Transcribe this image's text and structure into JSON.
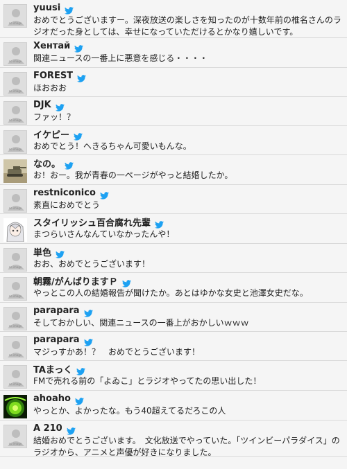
{
  "avatar_placeholder": "no image",
  "icons": {
    "account": "twitter-bird-icon",
    "color": "#1da1f2"
  },
  "tweets": [
    {
      "name": "yuusi",
      "text": "おめでとうございますー。深夜放送の楽しさを知ったのが十数年前の椎名さんのラジオだった身としては、幸せになっていただけるとかなり嬉しいです。",
      "avatar": "placeholder"
    },
    {
      "name": "Хентай",
      "text": "関連ニュースの一番上に悪意を感じる・・・・",
      "avatar": "placeholder"
    },
    {
      "name": "FOREST",
      "text": "ほおおお",
      "avatar": "placeholder"
    },
    {
      "name": "DJK",
      "text": "ファッ！？",
      "avatar": "placeholder"
    },
    {
      "name": "イケピー",
      "text": "おめでとう！へきるちゃん可愛いもんな。",
      "avatar": "placeholder"
    },
    {
      "name": "なの。",
      "text": "お！おー。我が青春の一ページがやっと結婚したか。",
      "avatar": "photo-tank"
    },
    {
      "name": "restniconico",
      "text": "素直におめでとう",
      "avatar": "placeholder"
    },
    {
      "name": "スタイリッシュ百合腐れ先輩",
      "text": "まつらいさんなんていなかったんや！",
      "avatar": "photo-anime"
    },
    {
      "name": "単色",
      "text": "おお、おめでとうございます！",
      "avatar": "placeholder"
    },
    {
      "name": "朝霧/がんばりますＰ",
      "text": "やっとこの人の結婚報告が聞けたか。あとはゆかな女史と池澤女史だな。",
      "avatar": "placeholder"
    },
    {
      "name": "parapara",
      "text": "そしておかしい、関連ニュースの一番上がおかしいｗｗｗ",
      "avatar": "placeholder"
    },
    {
      "name": "parapara",
      "text": "マジっすかあ！？　おめでとうございます！",
      "avatar": "placeholder"
    },
    {
      "name": "TAまっく",
      "text": "FMで売れる前の「よゐこ」とラジオやってたの思い出した！",
      "avatar": "placeholder"
    },
    {
      "name": "ahoaho",
      "text": "やっとか、よかったな。もう40超えてるだろこの人",
      "avatar": "photo-green"
    },
    {
      "name": "A 210",
      "text": "結婚おめでとうございます。　文化放送でやっていた。「ツインビーパラダイス」のラジオから、アニメと声優が好きになりました。",
      "avatar": "placeholder"
    }
  ]
}
